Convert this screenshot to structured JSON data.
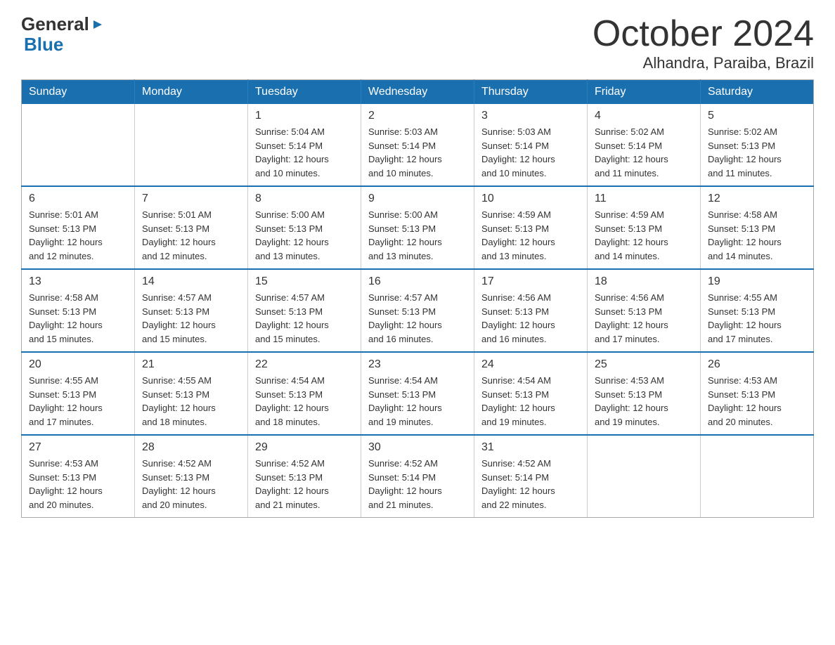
{
  "logo": {
    "general": "General",
    "blue": "Blue",
    "arrow": "▶"
  },
  "title": "October 2024",
  "subtitle": "Alhandra, Paraiba, Brazil",
  "days_of_week": [
    "Sunday",
    "Monday",
    "Tuesday",
    "Wednesday",
    "Thursday",
    "Friday",
    "Saturday"
  ],
  "weeks": [
    [
      {
        "day": "",
        "info": ""
      },
      {
        "day": "",
        "info": ""
      },
      {
        "day": "1",
        "info": "Sunrise: 5:04 AM\nSunset: 5:14 PM\nDaylight: 12 hours\nand 10 minutes."
      },
      {
        "day": "2",
        "info": "Sunrise: 5:03 AM\nSunset: 5:14 PM\nDaylight: 12 hours\nand 10 minutes."
      },
      {
        "day": "3",
        "info": "Sunrise: 5:03 AM\nSunset: 5:14 PM\nDaylight: 12 hours\nand 10 minutes."
      },
      {
        "day": "4",
        "info": "Sunrise: 5:02 AM\nSunset: 5:14 PM\nDaylight: 12 hours\nand 11 minutes."
      },
      {
        "day": "5",
        "info": "Sunrise: 5:02 AM\nSunset: 5:13 PM\nDaylight: 12 hours\nand 11 minutes."
      }
    ],
    [
      {
        "day": "6",
        "info": "Sunrise: 5:01 AM\nSunset: 5:13 PM\nDaylight: 12 hours\nand 12 minutes."
      },
      {
        "day": "7",
        "info": "Sunrise: 5:01 AM\nSunset: 5:13 PM\nDaylight: 12 hours\nand 12 minutes."
      },
      {
        "day": "8",
        "info": "Sunrise: 5:00 AM\nSunset: 5:13 PM\nDaylight: 12 hours\nand 13 minutes."
      },
      {
        "day": "9",
        "info": "Sunrise: 5:00 AM\nSunset: 5:13 PM\nDaylight: 12 hours\nand 13 minutes."
      },
      {
        "day": "10",
        "info": "Sunrise: 4:59 AM\nSunset: 5:13 PM\nDaylight: 12 hours\nand 13 minutes."
      },
      {
        "day": "11",
        "info": "Sunrise: 4:59 AM\nSunset: 5:13 PM\nDaylight: 12 hours\nand 14 minutes."
      },
      {
        "day": "12",
        "info": "Sunrise: 4:58 AM\nSunset: 5:13 PM\nDaylight: 12 hours\nand 14 minutes."
      }
    ],
    [
      {
        "day": "13",
        "info": "Sunrise: 4:58 AM\nSunset: 5:13 PM\nDaylight: 12 hours\nand 15 minutes."
      },
      {
        "day": "14",
        "info": "Sunrise: 4:57 AM\nSunset: 5:13 PM\nDaylight: 12 hours\nand 15 minutes."
      },
      {
        "day": "15",
        "info": "Sunrise: 4:57 AM\nSunset: 5:13 PM\nDaylight: 12 hours\nand 15 minutes."
      },
      {
        "day": "16",
        "info": "Sunrise: 4:57 AM\nSunset: 5:13 PM\nDaylight: 12 hours\nand 16 minutes."
      },
      {
        "day": "17",
        "info": "Sunrise: 4:56 AM\nSunset: 5:13 PM\nDaylight: 12 hours\nand 16 minutes."
      },
      {
        "day": "18",
        "info": "Sunrise: 4:56 AM\nSunset: 5:13 PM\nDaylight: 12 hours\nand 17 minutes."
      },
      {
        "day": "19",
        "info": "Sunrise: 4:55 AM\nSunset: 5:13 PM\nDaylight: 12 hours\nand 17 minutes."
      }
    ],
    [
      {
        "day": "20",
        "info": "Sunrise: 4:55 AM\nSunset: 5:13 PM\nDaylight: 12 hours\nand 17 minutes."
      },
      {
        "day": "21",
        "info": "Sunrise: 4:55 AM\nSunset: 5:13 PM\nDaylight: 12 hours\nand 18 minutes."
      },
      {
        "day": "22",
        "info": "Sunrise: 4:54 AM\nSunset: 5:13 PM\nDaylight: 12 hours\nand 18 minutes."
      },
      {
        "day": "23",
        "info": "Sunrise: 4:54 AM\nSunset: 5:13 PM\nDaylight: 12 hours\nand 19 minutes."
      },
      {
        "day": "24",
        "info": "Sunrise: 4:54 AM\nSunset: 5:13 PM\nDaylight: 12 hours\nand 19 minutes."
      },
      {
        "day": "25",
        "info": "Sunrise: 4:53 AM\nSunset: 5:13 PM\nDaylight: 12 hours\nand 19 minutes."
      },
      {
        "day": "26",
        "info": "Sunrise: 4:53 AM\nSunset: 5:13 PM\nDaylight: 12 hours\nand 20 minutes."
      }
    ],
    [
      {
        "day": "27",
        "info": "Sunrise: 4:53 AM\nSunset: 5:13 PM\nDaylight: 12 hours\nand 20 minutes."
      },
      {
        "day": "28",
        "info": "Sunrise: 4:52 AM\nSunset: 5:13 PM\nDaylight: 12 hours\nand 20 minutes."
      },
      {
        "day": "29",
        "info": "Sunrise: 4:52 AM\nSunset: 5:13 PM\nDaylight: 12 hours\nand 21 minutes."
      },
      {
        "day": "30",
        "info": "Sunrise: 4:52 AM\nSunset: 5:14 PM\nDaylight: 12 hours\nand 21 minutes."
      },
      {
        "day": "31",
        "info": "Sunrise: 4:52 AM\nSunset: 5:14 PM\nDaylight: 12 hours\nand 22 minutes."
      },
      {
        "day": "",
        "info": ""
      },
      {
        "day": "",
        "info": ""
      }
    ]
  ]
}
